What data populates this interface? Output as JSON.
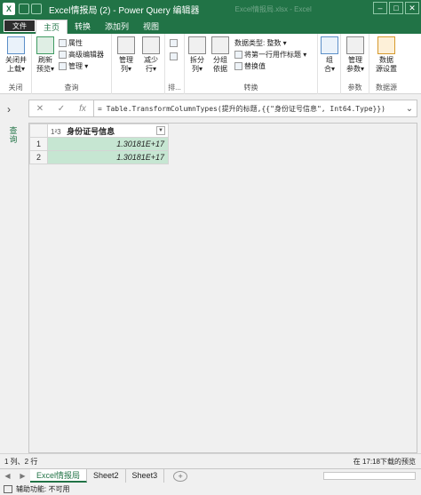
{
  "window": {
    "title": "Excel情报局 (2) - Power Query 编辑器",
    "background_title": "Excel情报局.xlsx - Excel",
    "controls": [
      "–",
      "□",
      "✕"
    ]
  },
  "tabs": {
    "file": "文件",
    "items": [
      "主页",
      "转换",
      "添加列",
      "视图"
    ],
    "active": "主页"
  },
  "ribbon": {
    "close": {
      "label_1": "关闭并",
      "label_2": "上载▾",
      "group": "关闭"
    },
    "query": {
      "refresh_1": "刷新",
      "refresh_2": "预览▾",
      "properties": "属性",
      "advanced_editor": "高级编辑器",
      "manage": "管理 ▾",
      "group": "查询"
    },
    "columns": {
      "manage_1": "管理",
      "manage_2": "列▾",
      "reduce_1": "减少",
      "reduce_2": "行▾"
    },
    "sort": {
      "group": "排..."
    },
    "transform": {
      "split_1": "拆分",
      "split_2": "列▾",
      "group_by_1": "分组",
      "group_by_2": "依据",
      "data_type": "数据类型: 整数 ▾",
      "first_row_header": "将第一行用作标题 ▾",
      "replace_values": "替换值",
      "group": "转换"
    },
    "combine": {
      "label_1": "组",
      "label_2": "合▾"
    },
    "parameters": {
      "label_1": "管理",
      "label_2": "参数▾",
      "group": "参数"
    },
    "datasource": {
      "label_1": "数据",
      "label_2": "源设置",
      "group": "数据源"
    }
  },
  "formula": {
    "cancel": "✕",
    "commit": "✓",
    "fx": "fx",
    "text": "= Table.TransformColumnTypes(提升的标题,{{\"身份证号信息\", Int64.Type}})",
    "expand": "⌄"
  },
  "sidepanel": {
    "label": "查询"
  },
  "grid": {
    "column": {
      "type_icon": "1²3",
      "name": "身份证号信息"
    },
    "rows": [
      {
        "num": "1",
        "value": "1.30181E+17"
      },
      {
        "num": "2",
        "value": "1.30181E+17"
      }
    ]
  },
  "status": {
    "left": "1 列、2 行",
    "right": "在 17:18下载的预览"
  },
  "sheets": {
    "tabs": [
      "Excel情报局",
      "Sheet2",
      "Sheet3"
    ],
    "active": "Excel情报局",
    "add": "+"
  },
  "bottom": {
    "accessibility": "辅助功能: 不可用"
  },
  "colors": {
    "brand": "#217346",
    "cell_highlight": "#c6e6d2"
  }
}
